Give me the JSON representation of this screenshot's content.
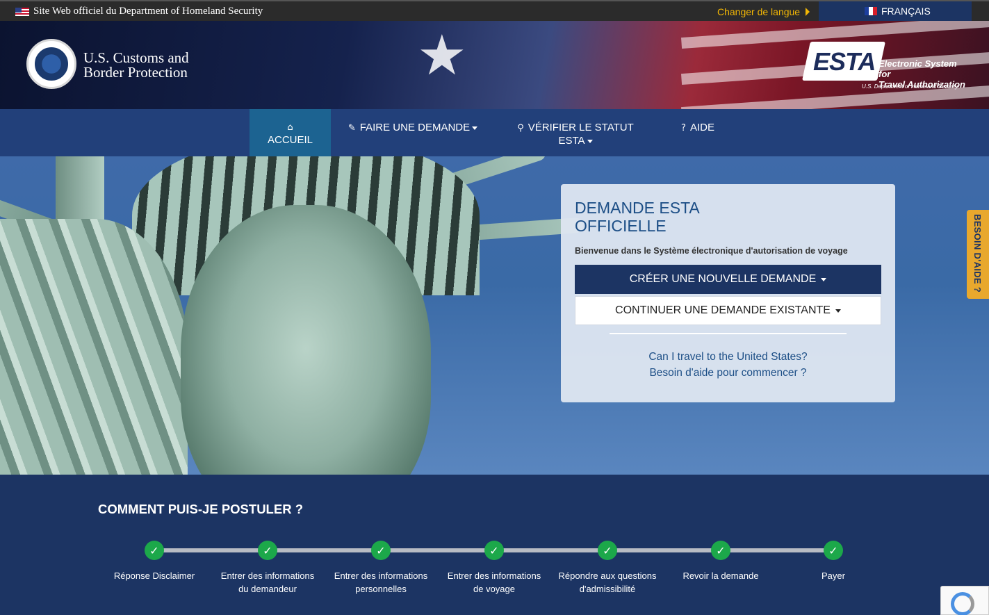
{
  "topbar": {
    "official_text": "Site Web officiel du Department of Homeland Security",
    "change_language": "Changer de langue",
    "current_language": "FRANÇAIS"
  },
  "header": {
    "agency_line1": "U.S. Customs and",
    "agency_line2": "Border Protection",
    "esta_word": "ESTA",
    "esta_tag1": "Electronic System for",
    "esta_tag2": "Travel Authorization",
    "esta_dhs": "U.S. Department of Homeland Security"
  },
  "nav": {
    "items": [
      {
        "label": "ACCUEIL",
        "icon": "home-icon"
      },
      {
        "label": "FAIRE UNE DEMANDE",
        "icon": "pencil-icon"
      },
      {
        "label": "VÉRIFIER LE STATUT",
        "label2": "ESTA",
        "icon": "search-icon"
      },
      {
        "label": "AIDE",
        "icon": "question-icon"
      }
    ]
  },
  "card": {
    "title_line1": "DEMANDE ESTA",
    "title_line2": "OFFICIELLE",
    "welcome": "Bienvenue dans le Système électronique d'autorisation de voyage",
    "primary_button": "CRÉER UNE NOUVELLE DEMANDE",
    "secondary_button": "CONTINUER UNE DEMANDE EXISTANTE",
    "link1": "Can I travel to the United States?",
    "link2": "Besoin d'aide pour commencer ?"
  },
  "help_tab": "BESOIN D'AIDE ?",
  "how": {
    "heading": "COMMENT PUIS-JE POSTULER ?",
    "steps": [
      {
        "line1": "Réponse Disclaimer",
        "line2": ""
      },
      {
        "line1": "Entrer des informations",
        "line2": "du demandeur"
      },
      {
        "line1": "Entrer des informations",
        "line2": "personnelles"
      },
      {
        "line1": "Entrer des informations",
        "line2": "de voyage"
      },
      {
        "line1": "Répondre aux questions",
        "line2": "d'admissibilité"
      },
      {
        "line1": "Revoir la demande",
        "line2": ""
      },
      {
        "line1": "Payer",
        "line2": ""
      }
    ]
  }
}
